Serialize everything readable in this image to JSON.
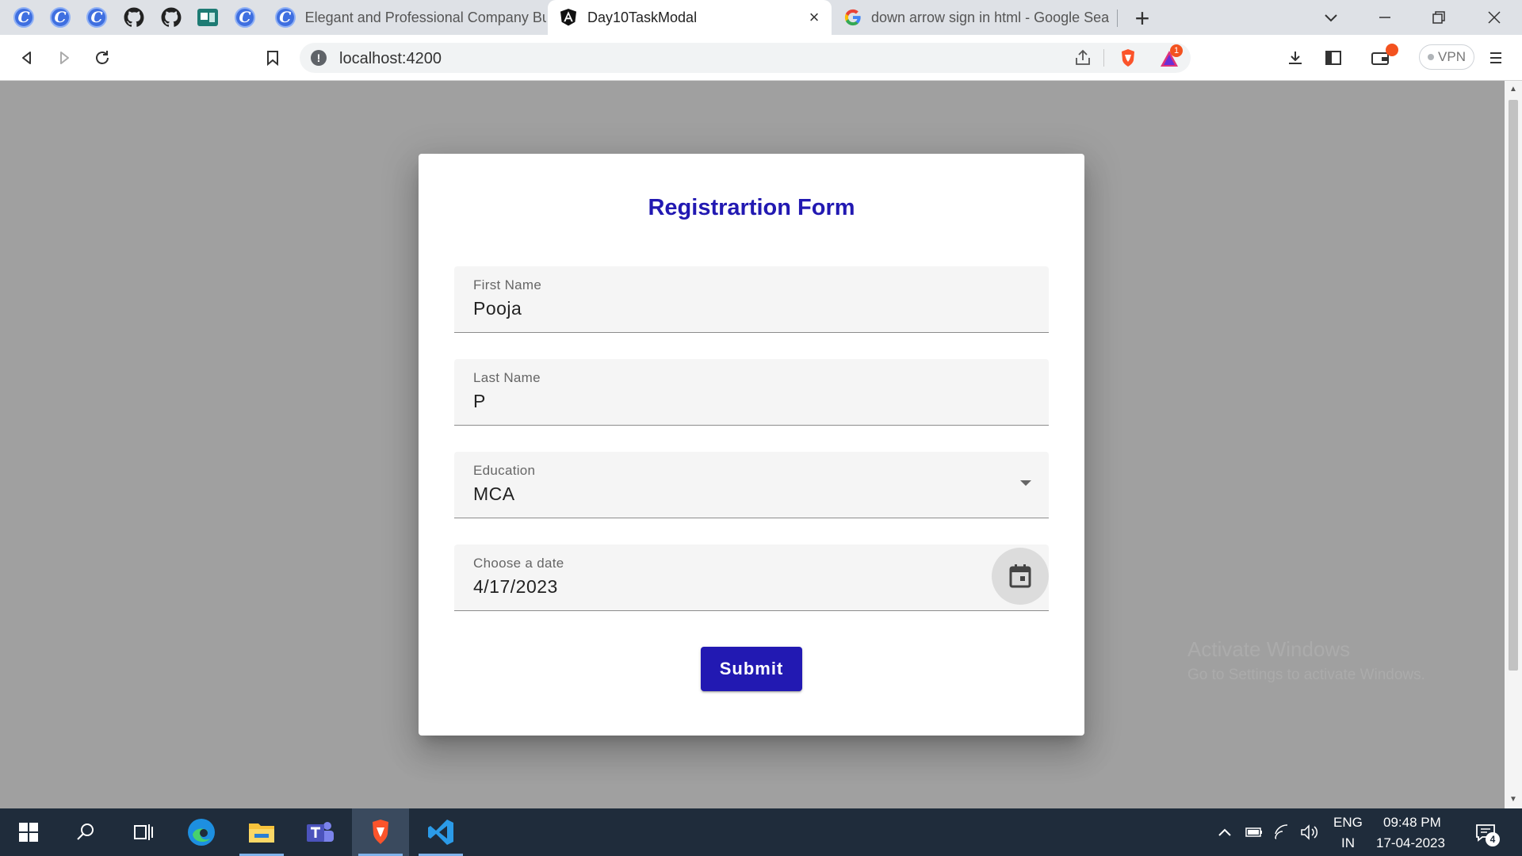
{
  "browser": {
    "tabs": [
      {
        "title": "Elegant and Professional Company Bu",
        "icon": "canva-icon",
        "active": false
      },
      {
        "title": "Day10TaskModal",
        "icon": "angular-icon",
        "active": true
      },
      {
        "title": "down arrow sign in html - Google Sea",
        "icon": "google-icon",
        "active": false
      }
    ],
    "url": "localhost:4200",
    "vpn_label": "VPN",
    "rewards_badge": "1"
  },
  "dialog": {
    "title": "Registrartion Form",
    "fields": [
      {
        "label": "First Name",
        "value": "Pooja"
      },
      {
        "label": "Last Name",
        "value": "P"
      },
      {
        "label": "Education",
        "value": "MCA"
      },
      {
        "label": "Choose a date",
        "value": "4/17/2023"
      }
    ],
    "submit_label": "Submit"
  },
  "watermark": {
    "line1": "Activate Windows",
    "line2": "Go to Settings to activate Windows."
  },
  "taskbar": {
    "lang_top": "ENG",
    "lang_bottom": "IN",
    "time": "09:48 PM",
    "date": "17-04-2023",
    "notification_count": "4"
  },
  "colors": {
    "accent": "#2219b2",
    "taskbar": "#1f2c3b",
    "tabstrip": "#dee1e6"
  }
}
